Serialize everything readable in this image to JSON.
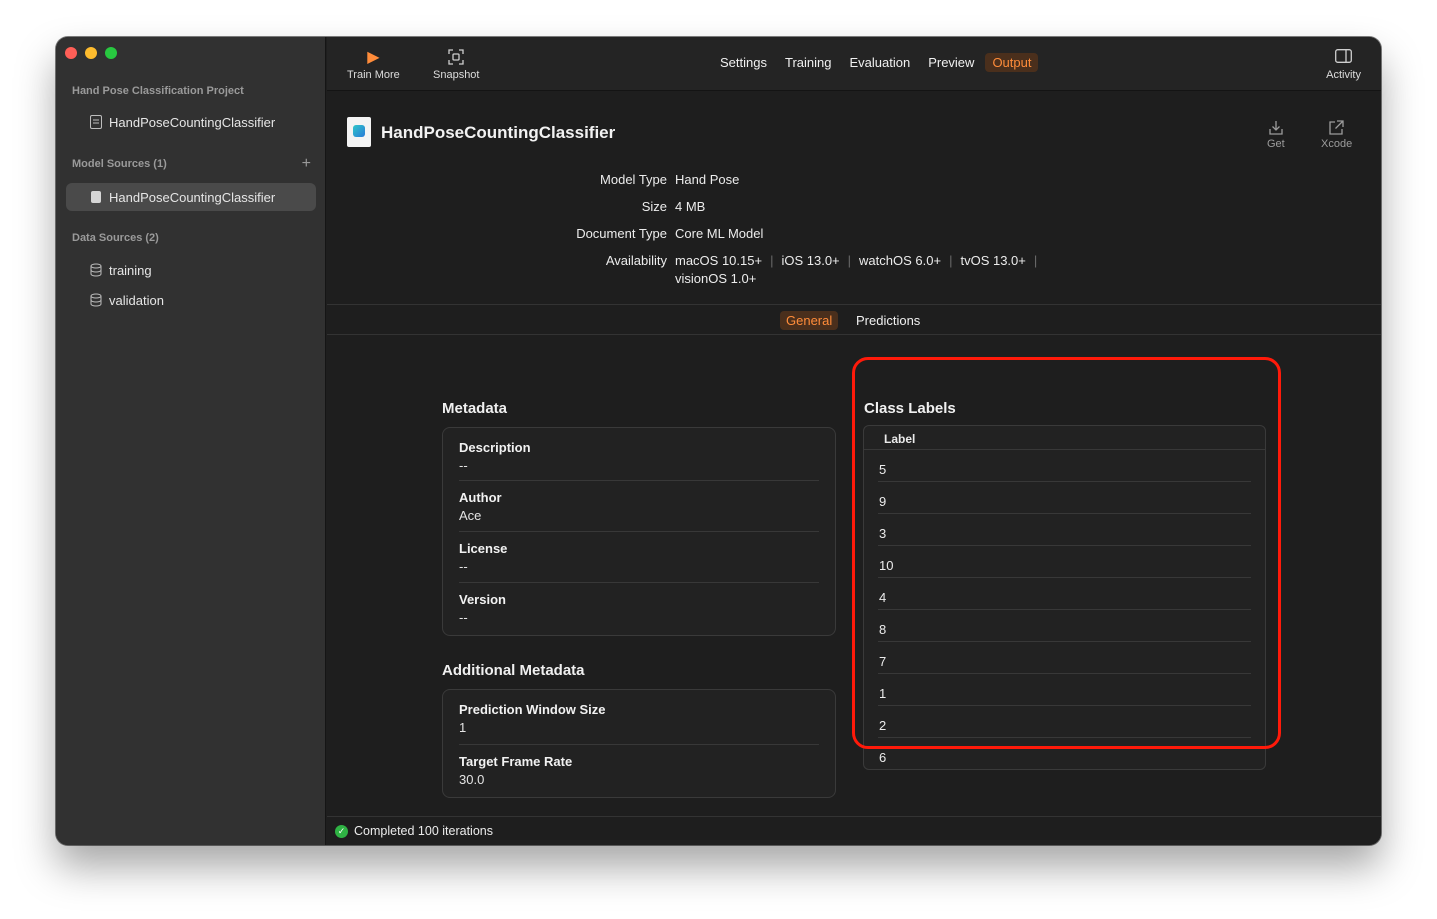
{
  "sidebar": {
    "project_title": "Hand Pose Classification Project",
    "project_item": "HandPoseCountingClassifier",
    "model_sources_title": "Model Sources (1)",
    "model_source_item": "HandPoseCountingClassifier",
    "data_sources_title": "Data Sources (2)",
    "data_sources": [
      "training",
      "validation"
    ]
  },
  "toolbar": {
    "train_more": "Train More",
    "snapshot": "Snapshot",
    "tabs": [
      "Settings",
      "Training",
      "Evaluation",
      "Preview",
      "Output"
    ],
    "active_tab": "Output",
    "activity": "Activity"
  },
  "model": {
    "title": "HandPoseCountingClassifier",
    "get_label": "Get",
    "xcode_label": "Xcode",
    "props": {
      "model_type_key": "Model Type",
      "model_type": "Hand Pose",
      "size_key": "Size",
      "size": "4 MB",
      "doc_type_key": "Document Type",
      "doc_type": "Core ML Model",
      "availability_key": "Availability",
      "availability": [
        "macOS 10.15+",
        "iOS 13.0+",
        "watchOS 6.0+",
        "tvOS 13.0+",
        "visionOS 1.0+"
      ]
    }
  },
  "subtabs": {
    "general": "General",
    "predictions": "Predictions",
    "active": "General"
  },
  "metadata": {
    "title": "Metadata",
    "fields": [
      {
        "key": "Description",
        "value": "--"
      },
      {
        "key": "Author",
        "value": "Ace"
      },
      {
        "key": "License",
        "value": "--"
      },
      {
        "key": "Version",
        "value": "--"
      }
    ]
  },
  "additional_metadata": {
    "title": "Additional Metadata",
    "fields": [
      {
        "key": "Prediction Window Size",
        "value": "1"
      },
      {
        "key": "Target Frame Rate",
        "value": "30.0"
      }
    ]
  },
  "class_labels": {
    "title": "Class Labels",
    "count": "10",
    "column": "Label",
    "items": [
      "5",
      "9",
      "3",
      "10",
      "4",
      "8",
      "7",
      "1",
      "2",
      "6"
    ]
  },
  "status": {
    "text": "Completed 100 iterations"
  },
  "colors": {
    "accent": "#ff8c3a",
    "highlight": "#ff1a0a",
    "success": "#2fb344"
  }
}
